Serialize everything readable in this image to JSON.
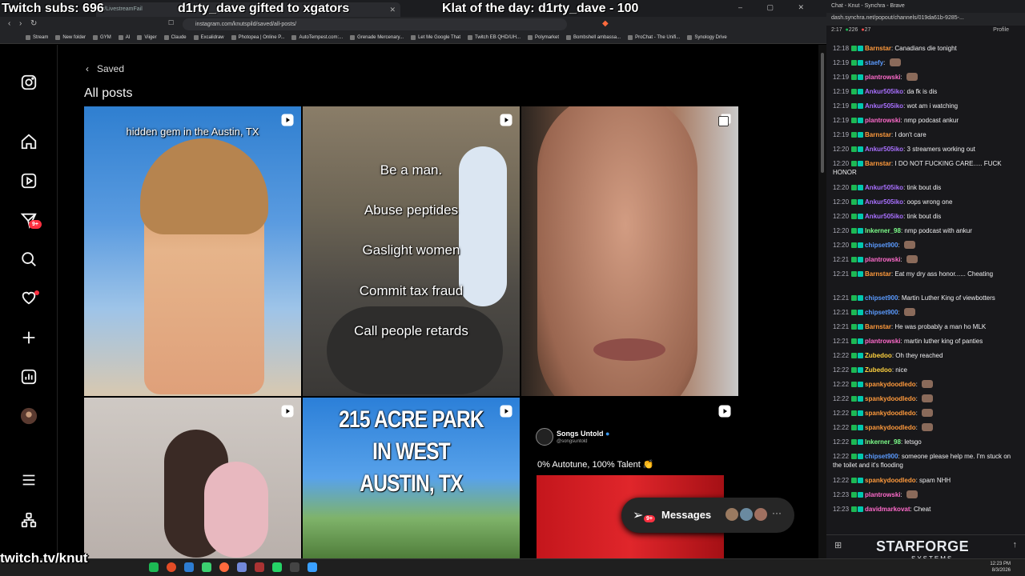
{
  "overlay": {
    "subs": "Twitch subs: 696",
    "gift": "d1rty_dave gifted to xgators",
    "klat": "Klat of the day: d1rty_dave - 100",
    "twitch_url": "twitch.tv/knut"
  },
  "browser": {
    "tab1": "r/LivestreamFail",
    "url": "instagram.com/knutspild/saved/all-posts/",
    "bookmarks": [
      "Stream",
      "New folder",
      "GYM",
      "AI",
      "Viiger",
      "Claude",
      "Excalidraw",
      "Photopea | Online P...",
      "AutoTempest.com:...",
      "Grenade Mercenary...",
      "Let Me Google That",
      "Twitch EB QHD/UH...",
      "Polymarket",
      "Bombshell ambassa...",
      "ProChat - The Unifi...",
      "Synology Drive"
    ]
  },
  "instagram": {
    "back_label": "Saved",
    "title": "All posts",
    "notifications_badge": "9+",
    "posts": {
      "p1_caption": "hidden gem in the Austin, TX",
      "p2_lines": [
        "Be a man.",
        "Abuse peptides",
        "Gaslight women",
        "Commit tax fraud",
        "Call people retards"
      ],
      "p5_caption": "215 ACRE PARK IN WEST AUSTIN, TX",
      "p6_account": "Songs Untold",
      "p6_handle": "@songsuntold",
      "p6_caption": "0% Autotune, 100% Talent 👏"
    },
    "messages_label": "Messages",
    "messages_badge": "9+"
  },
  "chat": {
    "tab_title": "Chat - Knut - Synchra - Brave",
    "url": "dash.synchra.net/popout/channels/019da61b-9285-...",
    "time": "2:17",
    "viewers": "226",
    "count2": "27",
    "profile": "Profile",
    "lines": [
      {
        "t": "12:18",
        "u": "Barnstar",
        "c": "#ff9a3c",
        "m": "Canadians die tonight"
      },
      {
        "t": "12:19",
        "u": "staefy",
        "c": "#5b9bff",
        "m": ""
      },
      {
        "t": "12:19",
        "u": "plantrowski",
        "c": "#ff6bcb",
        "m": ""
      },
      {
        "t": "12:19",
        "u": "Ankur505iko",
        "c": "#a970ff",
        "m": "da fk is dis"
      },
      {
        "t": "12:19",
        "u": "Ankur505iko",
        "c": "#a970ff",
        "m": "wot am i watching"
      },
      {
        "t": "12:19",
        "u": "plantrowski",
        "c": "#ff6bcb",
        "m": "nmp podcast ankur"
      },
      {
        "t": "12:19",
        "u": "Barnstar",
        "c": "#ff9a3c",
        "m": "I don't care"
      },
      {
        "t": "12:20",
        "u": "Ankur505iko",
        "c": "#a970ff",
        "m": "3 streamers working out"
      },
      {
        "t": "12:20",
        "u": "Barnstar",
        "c": "#ff9a3c",
        "m": "I DO NOT FUCKING CARE..... FUCK HONOR"
      },
      {
        "t": "12:20",
        "u": "Ankur505iko",
        "c": "#a970ff",
        "m": "tink bout dis"
      },
      {
        "t": "12:20",
        "u": "Ankur505iko",
        "c": "#a970ff",
        "m": "oops wrong one"
      },
      {
        "t": "12:20",
        "u": "Ankur505iko",
        "c": "#a970ff",
        "m": "tink bout dis"
      },
      {
        "t": "12:20",
        "u": "lnkerner_98",
        "c": "#7dff8a",
        "m": "nmp podcast with ankur"
      },
      {
        "t": "12:20",
        "u": "chipset900",
        "c": "#5b9bff",
        "m": ""
      },
      {
        "t": "12:21",
        "u": "plantrowski",
        "c": "#ff6bcb",
        "m": ""
      },
      {
        "t": "12:21",
        "u": "Barnstar",
        "c": "#ff9a3c",
        "m": "Eat my dry ass honor...... Cheating"
      },
      {
        "t": "12:21",
        "u": "chipset900",
        "c": "#5b9bff",
        "m": "Martin Luther King of viewbotters"
      },
      {
        "t": "12:21",
        "u": "chipset900",
        "c": "#5b9bff",
        "m": ""
      },
      {
        "t": "12:21",
        "u": "Barnstar",
        "c": "#ff9a3c",
        "m": "He was probably a man ho MLK"
      },
      {
        "t": "12:21",
        "u": "plantrowski",
        "c": "#ff6bcb",
        "m": "martin luther king of panties"
      },
      {
        "t": "12:22",
        "u": "Zubedoo",
        "c": "#ffd23f",
        "m": "Oh they reached"
      },
      {
        "t": "12:22",
        "u": "Zubedoo",
        "c": "#ffd23f",
        "m": "nice"
      },
      {
        "t": "12:22",
        "u": "spankydoodledo",
        "c": "#ff9a3c",
        "m": ""
      },
      {
        "t": "12:22",
        "u": "spankydoodledo",
        "c": "#ff9a3c",
        "m": ""
      },
      {
        "t": "12:22",
        "u": "spankydoodledo",
        "c": "#ff9a3c",
        "m": ""
      },
      {
        "t": "12:22",
        "u": "spankydoodledo",
        "c": "#ff9a3c",
        "m": ""
      },
      {
        "t": "12:22",
        "u": "lnkerner_98",
        "c": "#7dff8a",
        "m": "letsgo"
      },
      {
        "t": "12:22",
        "u": "chipset900",
        "c": "#5b9bff",
        "m": "someone please help me. I'm stuck on the toilet and it's flooding"
      },
      {
        "t": "12:22",
        "u": "spankydoodledo",
        "c": "#ff9a3c",
        "m": "spam NHH"
      },
      {
        "t": "12:23",
        "u": "plantrowski",
        "c": "#ff6bcb",
        "m": ""
      },
      {
        "t": "12:23",
        "u": "davidmarkovat",
        "c": "#ff6bcb",
        "m": "Cheat"
      }
    ]
  },
  "brand": {
    "name": "STARFORGE",
    "sub": "SYSTEMS"
  },
  "taskbar": {
    "time": "12:23 PM",
    "date": "8/3/2026"
  }
}
